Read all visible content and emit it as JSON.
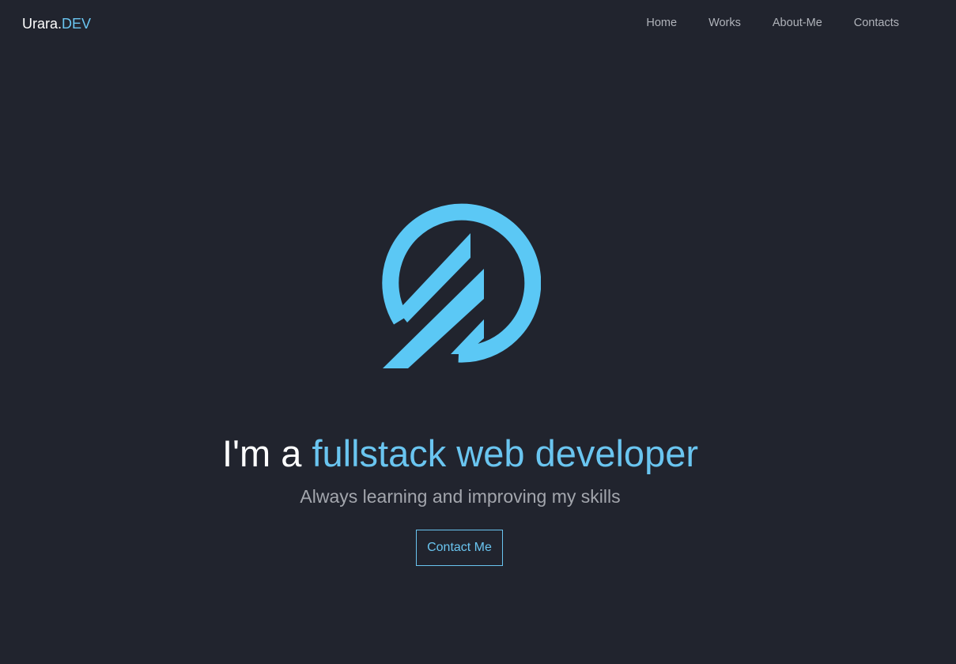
{
  "brand": {
    "name": "Urara.",
    "suffix": "DEV"
  },
  "nav": {
    "items": [
      "Home",
      "Works",
      "About-Me",
      "Contacts"
    ]
  },
  "hero": {
    "headline_prefix": "I'm a ",
    "headline_accent": "fullstack web developer",
    "subtitle": "Always learning and improving my skills",
    "cta_label": "Contact Me"
  },
  "colors": {
    "background": "#21242e",
    "accent": "#6ac5f0",
    "logo": "#5bc8f5",
    "nav_text": "#b0b3ba"
  },
  "icons": {
    "hero_logo": "circular-slash-logo-icon"
  }
}
